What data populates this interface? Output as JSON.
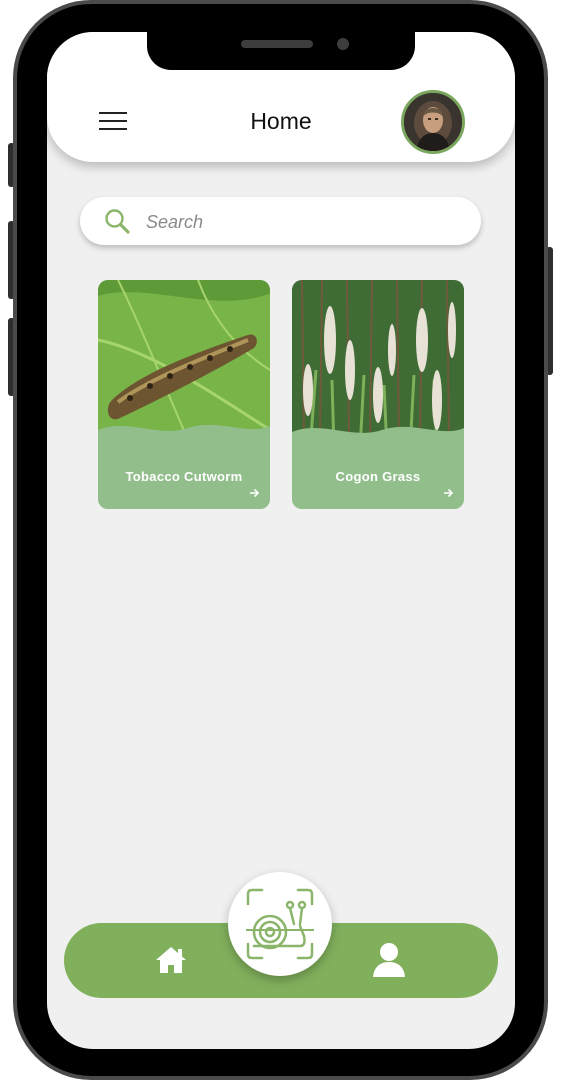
{
  "header": {
    "title": "Home",
    "menu_icon": "hamburger-menu-icon",
    "avatar": "user-avatar"
  },
  "search": {
    "placeholder": "Search",
    "value": "",
    "icon": "search-icon"
  },
  "cards": [
    {
      "label": "Tobacco Cutworm",
      "image": "caterpillar-on-leaf",
      "icon": "arrow-right-icon"
    },
    {
      "label": "Cogon Grass",
      "image": "cogon-grass-field",
      "icon": "arrow-right-icon"
    }
  ],
  "bottom_nav": {
    "items": [
      {
        "icon": "home-icon"
      },
      {
        "icon": "scan-snail-icon"
      },
      {
        "icon": "profile-icon"
      }
    ]
  },
  "colors": {
    "accent": "#80b05c",
    "card_overlay": "#92be8c",
    "background": "#f0f0f0",
    "frame": "#000000"
  }
}
